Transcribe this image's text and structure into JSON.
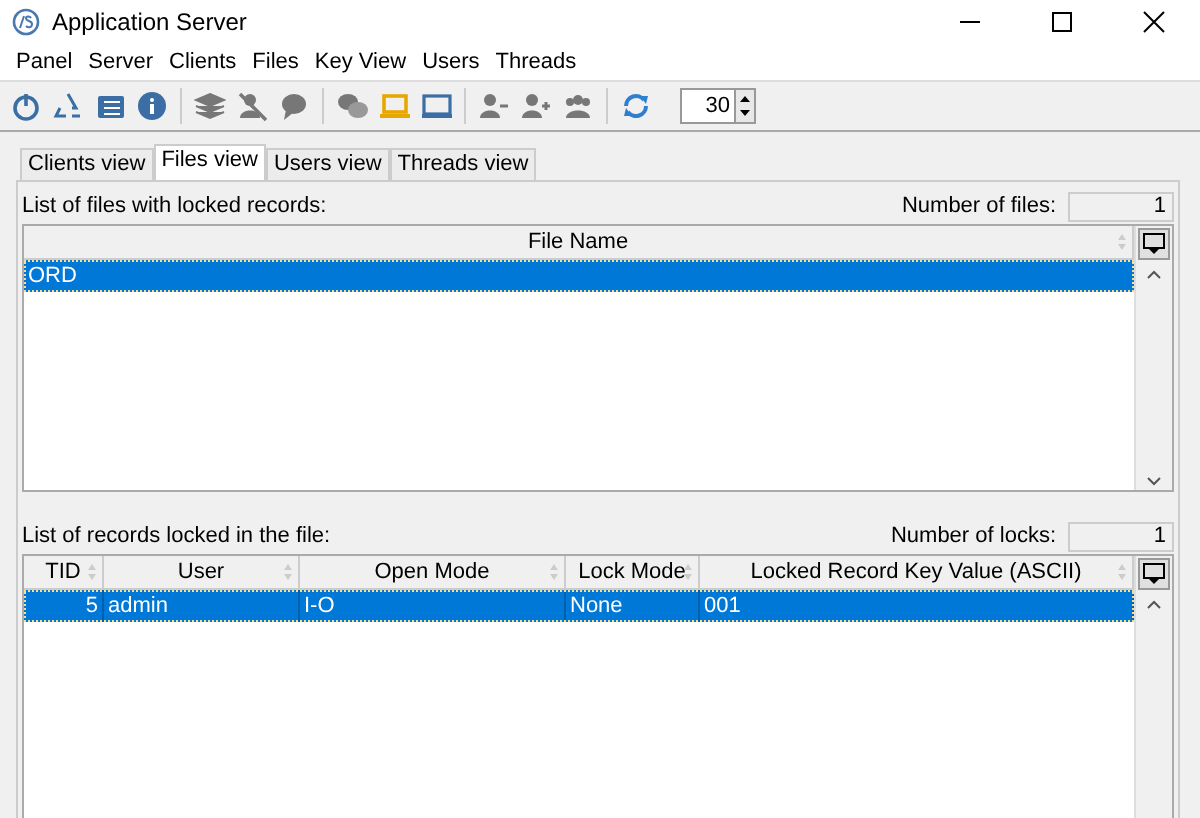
{
  "window": {
    "title": "Application Server"
  },
  "menu": [
    "Panel",
    "Server",
    "Clients",
    "Files",
    "Key View",
    "Users",
    "Threads"
  ],
  "toolbar": {
    "refresh_interval": "30"
  },
  "tabs": [
    {
      "label": "Clients view",
      "selected": false
    },
    {
      "label": "Files view",
      "selected": true
    },
    {
      "label": "Users view",
      "selected": false
    },
    {
      "label": "Threads view",
      "selected": false
    }
  ],
  "files": {
    "label": "List of files with locked records:",
    "count_label": "Number of files:",
    "count": "1",
    "columns": [
      {
        "label": "File Name"
      }
    ],
    "rows": [
      {
        "cells": [
          "ORD"
        ],
        "selected": true
      }
    ]
  },
  "locks": {
    "label": "List of records locked in the file:",
    "count_label": "Number of locks:",
    "count": "1",
    "columns": [
      {
        "label": "TID"
      },
      {
        "label": "User"
      },
      {
        "label": "Open Mode"
      },
      {
        "label": "Lock Mode"
      },
      {
        "label": "Locked Record Key Value (ASCII)"
      }
    ],
    "rows": [
      {
        "cells": [
          "5",
          "admin",
          "I-O",
          "None",
          "001"
        ],
        "selected": true
      }
    ]
  }
}
